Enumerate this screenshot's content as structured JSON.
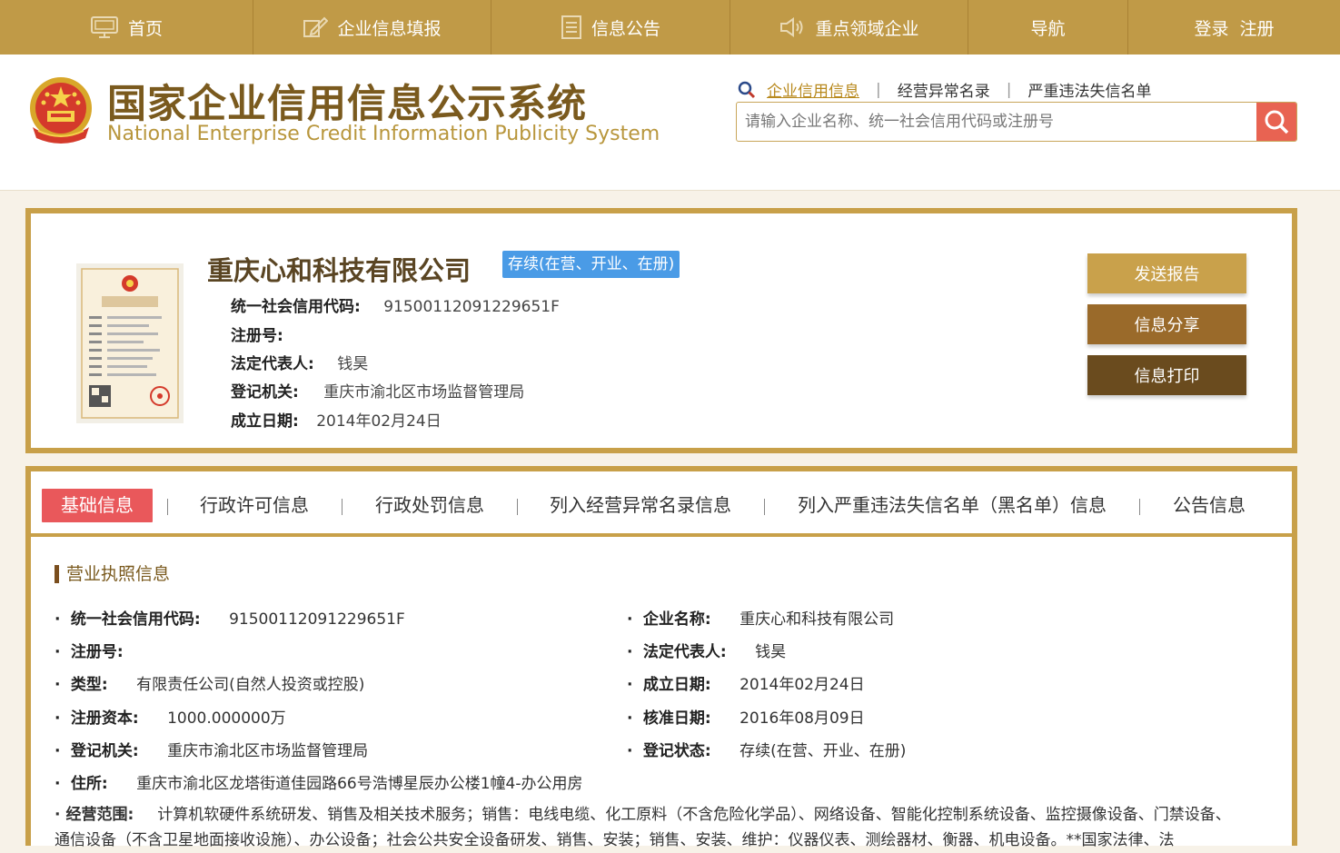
{
  "nav": {
    "home": "首页",
    "fill": "企业信息填报",
    "notice": "信息公告",
    "key": "重点领域企业",
    "guide": "导航",
    "login": "登录",
    "register": "注册"
  },
  "header": {
    "title_cn": "国家企业信用信息公示系统",
    "title_en": "National Enterprise Credit Information Publicity System",
    "search_links": [
      "企业信用信息",
      "经营异常名录",
      "严重违法失信名单"
    ],
    "search_placeholder": "请输入企业名称、统一社会信用代码或注册号"
  },
  "company": {
    "name": "重庆心和科技有限公司",
    "status": "存续(在营、开业、在册)",
    "credit_code_label": "统一社会信用代码:",
    "credit_code": "91500112091229651F",
    "reg_no_label": "注册号:",
    "reg_no": "",
    "legal_rep_label": "法定代表人:",
    "legal_rep": "钱昊",
    "authority_label": "登记机关:",
    "authority": "重庆市渝北区市场监督管理局",
    "est_date_label": "成立日期:",
    "est_date": "2014年02月24日",
    "buttons": {
      "send": "发送报告",
      "share": "信息分享",
      "print": "信息打印"
    }
  },
  "tabs": [
    "基础信息",
    "行政许可信息",
    "行政处罚信息",
    "列入经营异常名录信息",
    "列入严重违法失信名单（黑名单）信息",
    "公告信息"
  ],
  "details": {
    "section_title": "营业执照信息",
    "credit_code_label": "统一社会信用代码:",
    "credit_code": "91500112091229651F",
    "company_name_label": "企业名称:",
    "company_name": "重庆心和科技有限公司",
    "reg_no_label": "注册号:",
    "reg_no": "",
    "legal_rep_label": "法定代表人:",
    "legal_rep": "钱昊",
    "type_label": "类型:",
    "type": "有限责任公司(自然人投资或控股)",
    "est_date_label": "成立日期:",
    "est_date": "2014年02月24日",
    "capital_label": "注册资本:",
    "capital": "1000.000000万",
    "approve_date_label": "核准日期:",
    "approve_date": "2016年08月09日",
    "authority_label": "登记机关:",
    "authority": "重庆市渝北区市场监督管理局",
    "reg_status_label": "登记状态:",
    "reg_status": "存续(在营、开业、在册)",
    "address_label": "住所:",
    "address": "重庆市渝北区龙塔街道佳园路66号浩博星辰办公楼1幢4-办公用房",
    "scope_label": "经营范围:",
    "scope": "计算机软硬件系统研发、销售及相关技术服务；销售：电线电缆、化工原料（不含危险化学品）、网络设备、智能化控制系统设备、监控摄像设备、门禁设备、通信设备（不含卫星地面接收设施）、办公设备；社会公共安全设备研发、销售、安装；销售、安装、维护：仪器仪表、测绘器材、衡器、机电设备。**国家法律、法"
  },
  "colors": {
    "nav_bg": "#c09a47",
    "frame": "#c8a049",
    "badge": "#4a9be6",
    "active_tab": "#e9585b",
    "search_btn": "#e86352"
  }
}
